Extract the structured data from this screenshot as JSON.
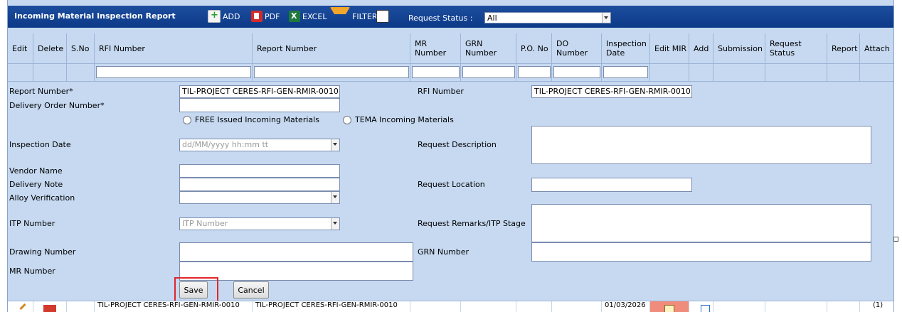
{
  "header": {
    "title": "Incoming Material Inspection Report",
    "add_label": "ADD",
    "pdf_label": "PDF",
    "excel_label": "EXCEL",
    "filter_label": "FILTER",
    "request_status_label": "Request Status :",
    "request_status_value": "All"
  },
  "columns": [
    "Edit",
    "Delete",
    "S.No",
    "RFI Number",
    "Report Number",
    "MR Number",
    "GRN Number",
    "P.O. No",
    "DO Number",
    "Inspection Date",
    "Edit MIR",
    "Add",
    "Submission",
    "Request Status",
    "Report",
    "Attach"
  ],
  "form": {
    "report_number_label": "Report Number*",
    "report_number_value": "TIL-PROJECT CERES-RFI-GEN-RMIR-0010",
    "rfi_number_label": "RFI Number",
    "rfi_number_value": "TIL-PROJECT CERES-RFI-GEN-RMIR-0010",
    "delivery_order_label": "Delivery Order Number*",
    "radio_free": "FREE Issued Incoming Materials",
    "radio_tema": "TEMA Incoming Materials",
    "inspection_date_label": "Inspection Date",
    "inspection_date_placeholder": "dd/MM/yyyy hh:mm tt",
    "request_description_label": "Request Description",
    "vendor_name_label": "Vendor Name",
    "delivery_note_label": "Delivery Note",
    "request_location_label": "Request Location",
    "alloy_verification_label": "Alloy Verification",
    "itp_number_label": "ITP Number",
    "itp_number_placeholder": "ITP Number",
    "request_remarks_label": "Request Remarks/ITP Stage",
    "drawing_number_label": "Drawing Number",
    "grn_number_label": "GRN Number",
    "mr_number_label": "MR Number",
    "save_label": "Save",
    "cancel_label": "Cancel"
  },
  "bottom_row": {
    "rfi": "TIL-PROJECT CERES-RFI-GEN-RMIR-0010",
    "report": "TIL-PROJECT CERES-RFI-GEN-RMIR-0010",
    "inspection_date": "01/03/2026",
    "attach": "(1)"
  },
  "colors": {
    "header_bg": "#0c3a88",
    "panel_bg": "#c6d9f1",
    "highlight": "#e0262b"
  }
}
